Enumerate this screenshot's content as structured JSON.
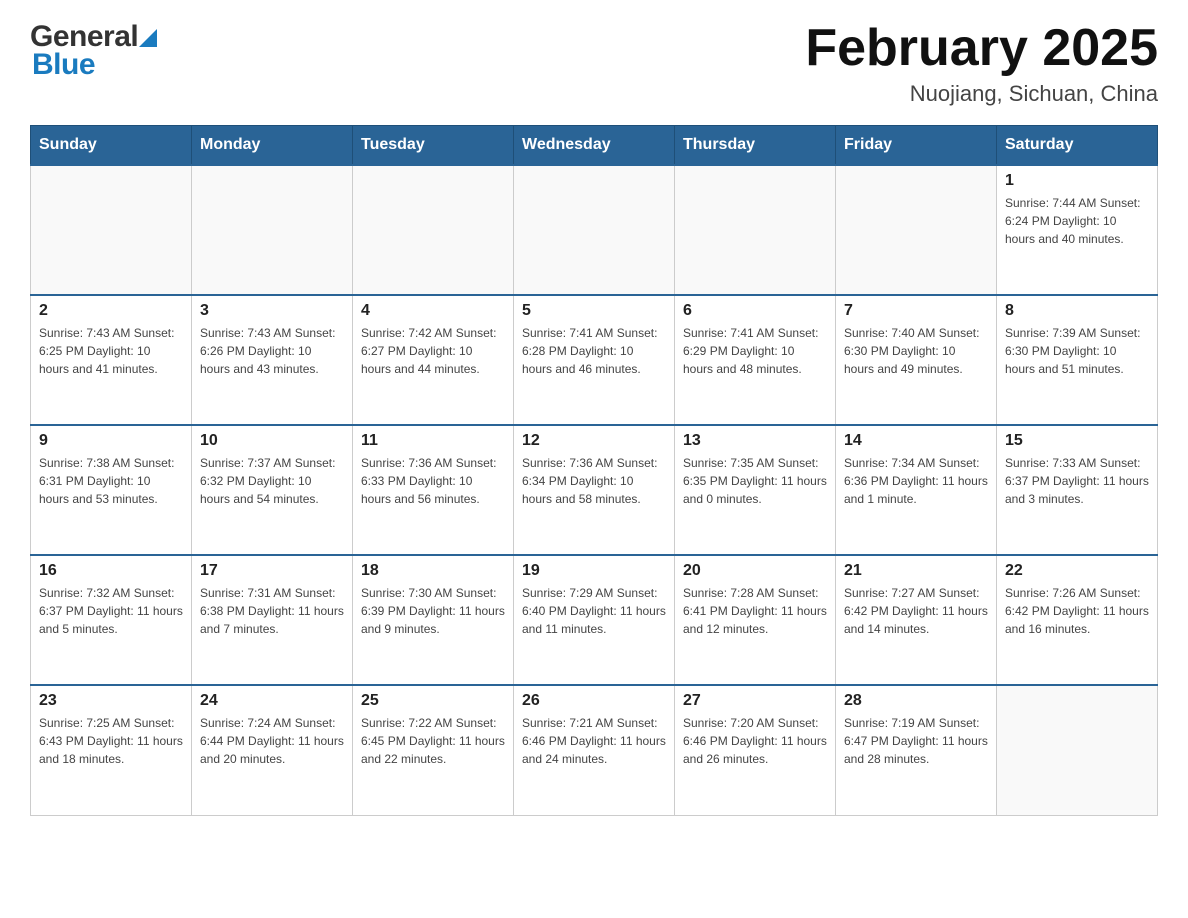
{
  "header": {
    "logo_general": "General",
    "logo_blue": "Blue",
    "title": "February 2025",
    "subtitle": "Nuojiang, Sichuan, China"
  },
  "weekdays": [
    "Sunday",
    "Monday",
    "Tuesday",
    "Wednesday",
    "Thursday",
    "Friday",
    "Saturday"
  ],
  "weeks": [
    [
      {
        "day": "",
        "info": ""
      },
      {
        "day": "",
        "info": ""
      },
      {
        "day": "",
        "info": ""
      },
      {
        "day": "",
        "info": ""
      },
      {
        "day": "",
        "info": ""
      },
      {
        "day": "",
        "info": ""
      },
      {
        "day": "1",
        "info": "Sunrise: 7:44 AM\nSunset: 6:24 PM\nDaylight: 10 hours\nand 40 minutes."
      }
    ],
    [
      {
        "day": "2",
        "info": "Sunrise: 7:43 AM\nSunset: 6:25 PM\nDaylight: 10 hours\nand 41 minutes."
      },
      {
        "day": "3",
        "info": "Sunrise: 7:43 AM\nSunset: 6:26 PM\nDaylight: 10 hours\nand 43 minutes."
      },
      {
        "day": "4",
        "info": "Sunrise: 7:42 AM\nSunset: 6:27 PM\nDaylight: 10 hours\nand 44 minutes."
      },
      {
        "day": "5",
        "info": "Sunrise: 7:41 AM\nSunset: 6:28 PM\nDaylight: 10 hours\nand 46 minutes."
      },
      {
        "day": "6",
        "info": "Sunrise: 7:41 AM\nSunset: 6:29 PM\nDaylight: 10 hours\nand 48 minutes."
      },
      {
        "day": "7",
        "info": "Sunrise: 7:40 AM\nSunset: 6:30 PM\nDaylight: 10 hours\nand 49 minutes."
      },
      {
        "day": "8",
        "info": "Sunrise: 7:39 AM\nSunset: 6:30 PM\nDaylight: 10 hours\nand 51 minutes."
      }
    ],
    [
      {
        "day": "9",
        "info": "Sunrise: 7:38 AM\nSunset: 6:31 PM\nDaylight: 10 hours\nand 53 minutes."
      },
      {
        "day": "10",
        "info": "Sunrise: 7:37 AM\nSunset: 6:32 PM\nDaylight: 10 hours\nand 54 minutes."
      },
      {
        "day": "11",
        "info": "Sunrise: 7:36 AM\nSunset: 6:33 PM\nDaylight: 10 hours\nand 56 minutes."
      },
      {
        "day": "12",
        "info": "Sunrise: 7:36 AM\nSunset: 6:34 PM\nDaylight: 10 hours\nand 58 minutes."
      },
      {
        "day": "13",
        "info": "Sunrise: 7:35 AM\nSunset: 6:35 PM\nDaylight: 11 hours\nand 0 minutes."
      },
      {
        "day": "14",
        "info": "Sunrise: 7:34 AM\nSunset: 6:36 PM\nDaylight: 11 hours\nand 1 minute."
      },
      {
        "day": "15",
        "info": "Sunrise: 7:33 AM\nSunset: 6:37 PM\nDaylight: 11 hours\nand 3 minutes."
      }
    ],
    [
      {
        "day": "16",
        "info": "Sunrise: 7:32 AM\nSunset: 6:37 PM\nDaylight: 11 hours\nand 5 minutes."
      },
      {
        "day": "17",
        "info": "Sunrise: 7:31 AM\nSunset: 6:38 PM\nDaylight: 11 hours\nand 7 minutes."
      },
      {
        "day": "18",
        "info": "Sunrise: 7:30 AM\nSunset: 6:39 PM\nDaylight: 11 hours\nand 9 minutes."
      },
      {
        "day": "19",
        "info": "Sunrise: 7:29 AM\nSunset: 6:40 PM\nDaylight: 11 hours\nand 11 minutes."
      },
      {
        "day": "20",
        "info": "Sunrise: 7:28 AM\nSunset: 6:41 PM\nDaylight: 11 hours\nand 12 minutes."
      },
      {
        "day": "21",
        "info": "Sunrise: 7:27 AM\nSunset: 6:42 PM\nDaylight: 11 hours\nand 14 minutes."
      },
      {
        "day": "22",
        "info": "Sunrise: 7:26 AM\nSunset: 6:42 PM\nDaylight: 11 hours\nand 16 minutes."
      }
    ],
    [
      {
        "day": "23",
        "info": "Sunrise: 7:25 AM\nSunset: 6:43 PM\nDaylight: 11 hours\nand 18 minutes."
      },
      {
        "day": "24",
        "info": "Sunrise: 7:24 AM\nSunset: 6:44 PM\nDaylight: 11 hours\nand 20 minutes."
      },
      {
        "day": "25",
        "info": "Sunrise: 7:22 AM\nSunset: 6:45 PM\nDaylight: 11 hours\nand 22 minutes."
      },
      {
        "day": "26",
        "info": "Sunrise: 7:21 AM\nSunset: 6:46 PM\nDaylight: 11 hours\nand 24 minutes."
      },
      {
        "day": "27",
        "info": "Sunrise: 7:20 AM\nSunset: 6:46 PM\nDaylight: 11 hours\nand 26 minutes."
      },
      {
        "day": "28",
        "info": "Sunrise: 7:19 AM\nSunset: 6:47 PM\nDaylight: 11 hours\nand 28 minutes."
      },
      {
        "day": "",
        "info": ""
      }
    ]
  ]
}
